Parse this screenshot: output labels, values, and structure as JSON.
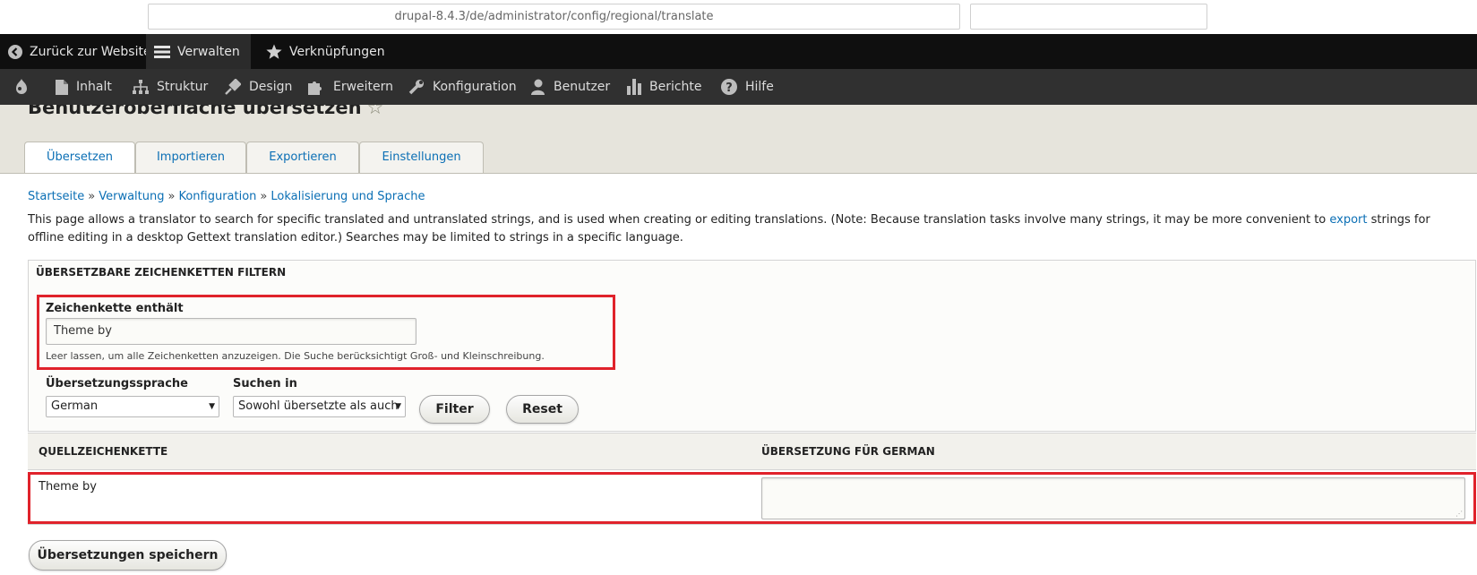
{
  "browser": {
    "url": "drupal-8.4.3/de/administrator/config/regional/translate"
  },
  "toolbar": {
    "back_label": "Zurück zur Website",
    "manage_label": "Verwalten",
    "shortcuts_label": "Verknüpfungen"
  },
  "admin_menu": {
    "items": [
      {
        "label": "Inhalt",
        "icon": "file-icon"
      },
      {
        "label": "Struktur",
        "icon": "structure-icon"
      },
      {
        "label": "Design",
        "icon": "paintbrush-icon"
      },
      {
        "label": "Erweitern",
        "icon": "puzzle-icon"
      },
      {
        "label": "Konfiguration",
        "icon": "wrench-icon"
      },
      {
        "label": "Benutzer",
        "icon": "person-icon"
      },
      {
        "label": "Berichte",
        "icon": "bar-chart-icon"
      },
      {
        "label": "Hilfe",
        "icon": "help-icon"
      }
    ]
  },
  "page": {
    "title": "Benutzeroberfläche übersetzen",
    "star": "☆"
  },
  "tabs": [
    {
      "label": "Übersetzen",
      "active": true
    },
    {
      "label": "Importieren",
      "active": false
    },
    {
      "label": "Exportieren",
      "active": false
    },
    {
      "label": "Einstellungen",
      "active": false
    }
  ],
  "breadcrumb": {
    "items": [
      "Startseite",
      "Verwaltung",
      "Konfiguration",
      "Lokalisierung und Sprache"
    ],
    "separator": "»"
  },
  "description": {
    "before_link": "This page allows a translator to search for specific translated and untranslated strings, and is used when creating or editing translations. (Note: Because translation tasks involve many strings, it may be more convenient to ",
    "link": "export",
    "after_link": " strings for offline editing in a desktop Gettext translation editor.) Searches may be limited to strings in a specific language."
  },
  "filter": {
    "legend": "ÜBERSETZBARE ZEICHENKETTEN FILTERN",
    "string_label": "Zeichenkette enthält",
    "string_value": "Theme by",
    "string_help": "Leer lassen, um alle Zeichenketten anzuzeigen. Die Suche berücksichtigt Groß- und Kleinschreibung.",
    "language_label": "Übersetzungssprache",
    "language_value": "German",
    "search_in_label": "Suchen in",
    "search_in_value": "Sowohl übersetzte als auch",
    "filter_button": "Filter",
    "reset_button": "Reset"
  },
  "table": {
    "col_source": "QUELLZEICHENKETTE",
    "col_translation": "ÜBERSETZUNG FÜR GERMAN",
    "rows": [
      {
        "source": "Theme by",
        "translation": ""
      }
    ]
  },
  "save_button": "Übersetzungen speichern",
  "colors": {
    "link": "#0b6fb5",
    "toolbar_dark": "#0f0f0f",
    "toolbar_tray": "#303030",
    "highlight": "#e0222b"
  }
}
